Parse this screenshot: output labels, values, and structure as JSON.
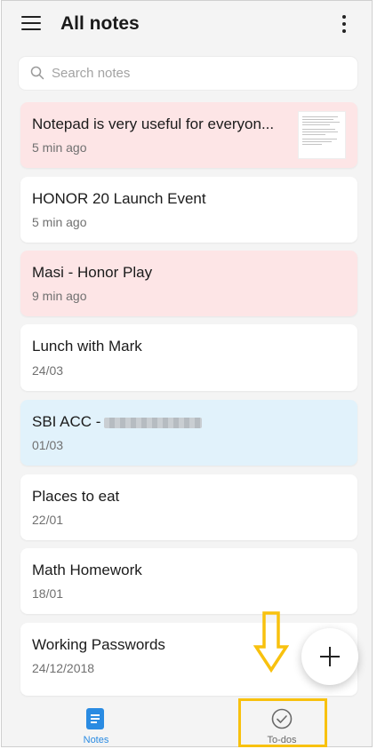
{
  "header": {
    "title": "All notes"
  },
  "search": {
    "placeholder": "Search notes"
  },
  "notes": [
    {
      "title": "Notepad is very useful for everyon...",
      "date": "5 min ago",
      "color": "#fde5e6"
    },
    {
      "title": "HONOR 20 Launch Event",
      "date": "5 min ago",
      "color": "#ffffff"
    },
    {
      "title": "Masi - Honor Play",
      "date": "9 min ago",
      "color": "#fde5e6"
    },
    {
      "title": "Lunch with Mark",
      "date": "24/03",
      "color": "#ffffff"
    },
    {
      "title": "SBI ACC -",
      "date": "01/03",
      "color": "#e1f2fb"
    },
    {
      "title": "Places to eat",
      "date": "22/01",
      "color": "#ffffff"
    },
    {
      "title": "Math Homework",
      "date": "18/01",
      "color": "#ffffff"
    },
    {
      "title": "Working Passwords",
      "date": "24/12/2018",
      "color": "#ffffff"
    }
  ],
  "bottom_nav": {
    "notes_label": "Notes",
    "todos_label": "To-dos",
    "active_color": "#2a8be2",
    "inactive_color": "#6a6a6a"
  },
  "annotation": {
    "highlight_color": "#f8c10e"
  }
}
